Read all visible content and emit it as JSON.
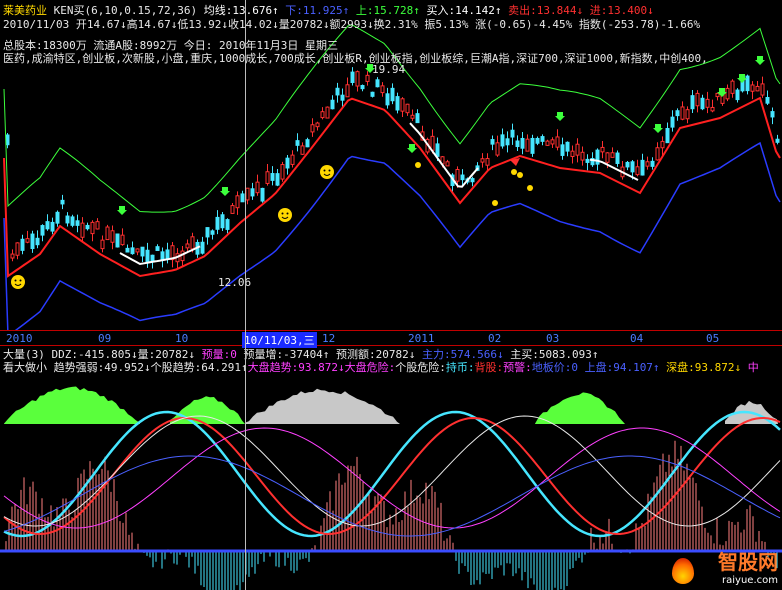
{
  "header": {
    "line1": [
      {
        "text": "莱美药业",
        "color": "#ffd800"
      },
      {
        "text": " KEN买(6,10,0.15,72,36) ",
        "color": "#e8e8e8"
      },
      {
        "text": "均线:13.676↑",
        "color": "#ffffff"
      },
      {
        "text": " 下:11.925↑",
        "color": "#4a60ff"
      },
      {
        "text": " 上:15.728↑",
        "color": "#3cff3c"
      },
      {
        "text": " 买入:14.142↑",
        "color": "#ffffff"
      },
      {
        "text": " 卖出:13.844↓",
        "color": "#ff3030"
      },
      {
        "text": " 进:13.400↓",
        "color": "#ff3030"
      }
    ],
    "line2": "2010/11/03 开14.67↓高14.67↓低13.92↓收14.02↓量20782↓额2993↓换2.31% 振5.13% 涨(-0.65)-4.45% 指数(-253.78)-1.66%",
    "line3": "总股本:18300万   流通A股:8992万        今日: 2010年11月3日 星期三",
    "line4": "医药,成渝特区,创业板,次新股,小盘,重庆,1000成长,700成长,创业板R,创业板指,创业板综,巨潮A指,深证700,深证1000,新指数,中创400,",
    "price_label_high": "19.94",
    "price_label_low": "12.06"
  },
  "date_axis": {
    "ticks": [
      "2010",
      "09",
      "10",
      "12",
      "2011",
      "02",
      "03",
      "04",
      "05"
    ],
    "cursor_label": "10/11/03,三"
  },
  "indicator": {
    "line1": [
      {
        "text": "大量(3) DDZ:-415.805↓",
        "color": "#e8e8e8"
      },
      {
        "text": "量:20782↓",
        "color": "#e8e8e8"
      },
      {
        "text": " 预量:0",
        "color": "#ff40ff"
      },
      {
        "text": " 预量增:-37404↑",
        "color": "#e8e8e8"
      },
      {
        "text": " 预测额:20782↓",
        "color": "#e8e8e8"
      },
      {
        "text": " 主力:574.566↓",
        "color": "#4a60ff"
      },
      {
        "text": " 主买:5083.093↑",
        "color": "#e8e8e8"
      }
    ],
    "line2": [
      {
        "text": "看大做小 ",
        "color": "#e8e8e8"
      },
      {
        "text": "趋势强弱:49.952↓",
        "color": "#e8e8e8"
      },
      {
        "text": "个股趋势:64.291↑",
        "color": "#e8e8e8"
      },
      {
        "text": "大盘趋势:93.872↓",
        "color": "#ff40ff"
      },
      {
        "text": "大盘危险:",
        "color": "#ff40ff"
      },
      {
        "text": "个股危险:",
        "color": "#e8e8e8"
      },
      {
        "text": "持币:",
        "color": "#46e6ff"
      },
      {
        "text": "背股:",
        "color": "#ff3030"
      },
      {
        "text": "预警:",
        "color": "#ff40ff"
      },
      {
        "text": "地板价:0",
        "color": "#4a60ff"
      },
      {
        "text": " 上盘:94.107↑",
        "color": "#4a60ff"
      },
      {
        "text": " 深盘:93.872↓",
        "color": "#ffd800"
      },
      {
        "text": " 中",
        "color": "#ff40ff"
      }
    ]
  },
  "watermark": {
    "main": "智股网",
    "sub": "raiyue.com"
  },
  "colors": {
    "background": "#000000",
    "candle_up": "#ff3030",
    "candle_down": "#46e6ff",
    "ma_red": "#ff2020",
    "ma_white": "#ffffff",
    "band_green": "#3cff3c",
    "band_blue": "#2a3cff",
    "area_green": "#5aff3c",
    "area_gray": "#c8c8c8",
    "bars_pos": "#ff8080",
    "bars_neg": "#46e6ff"
  }
}
